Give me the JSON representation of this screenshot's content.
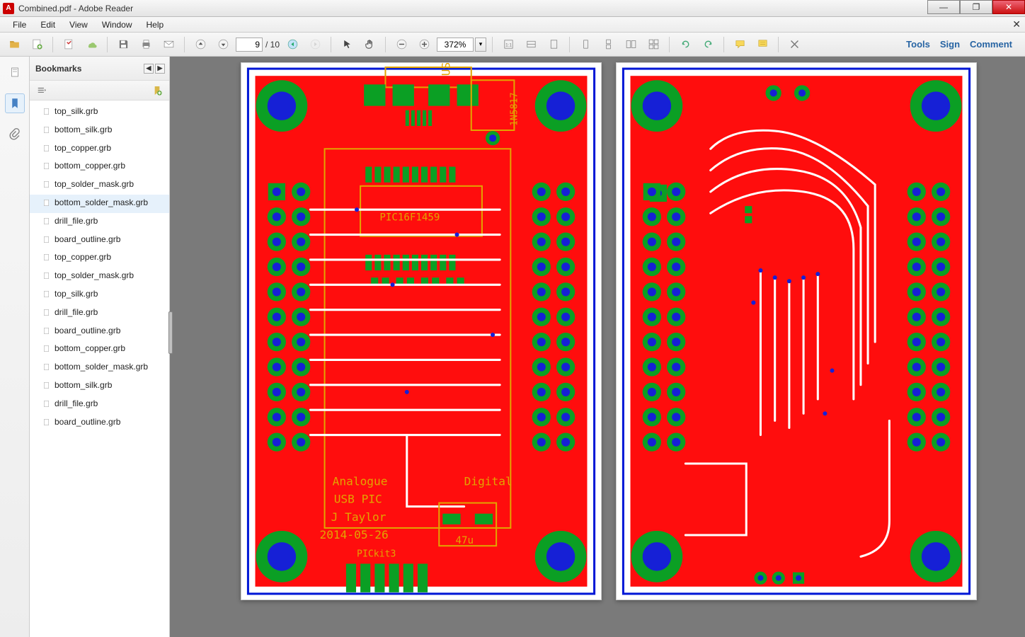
{
  "titlebar": {
    "app_icon_letter": "A",
    "title": "Combined.pdf - Adobe Reader",
    "min": "—",
    "max": "❐",
    "close": "✕"
  },
  "menu": {
    "items": [
      "File",
      "Edit",
      "View",
      "Window",
      "Help"
    ],
    "doc_close": "✕"
  },
  "toolbar": {
    "page_current": "9",
    "page_total": "/ 10",
    "zoom": "372%",
    "right": {
      "tools": "Tools",
      "sign": "Sign",
      "comment": "Comment"
    }
  },
  "sidebar": {
    "header": "Bookmarks",
    "items": [
      {
        "label": "top_silk.grb"
      },
      {
        "label": "bottom_silk.grb"
      },
      {
        "label": "top_copper.grb"
      },
      {
        "label": "bottom_copper.grb"
      },
      {
        "label": "top_solder_mask.grb"
      },
      {
        "label": "bottom_solder_mask.grb",
        "selected": true
      },
      {
        "label": "drill_file.grb"
      },
      {
        "label": "board_outline.grb"
      },
      {
        "label": "top_copper.grb"
      },
      {
        "label": "top_solder_mask.grb"
      },
      {
        "label": "top_silk.grb"
      },
      {
        "label": "drill_file.grb"
      },
      {
        "label": "board_outline.grb"
      },
      {
        "label": "bottom_copper.grb"
      },
      {
        "label": "bottom_solder_mask.grb"
      },
      {
        "label": "bottom_silk.grb"
      },
      {
        "label": "drill_file.grb"
      },
      {
        "label": "board_outline.grb"
      }
    ]
  },
  "pcb": {
    "silk_texts": {
      "usb": "USB",
      "diode": "1N5817",
      "chip": "PIC16F1459",
      "analogue": "Analogue",
      "digital": "Digital",
      "line1": "USB PIC",
      "line2": "J Taylor",
      "line3": "2014-05-26",
      "pickit": "PICkit3",
      "cap": "47u"
    }
  }
}
